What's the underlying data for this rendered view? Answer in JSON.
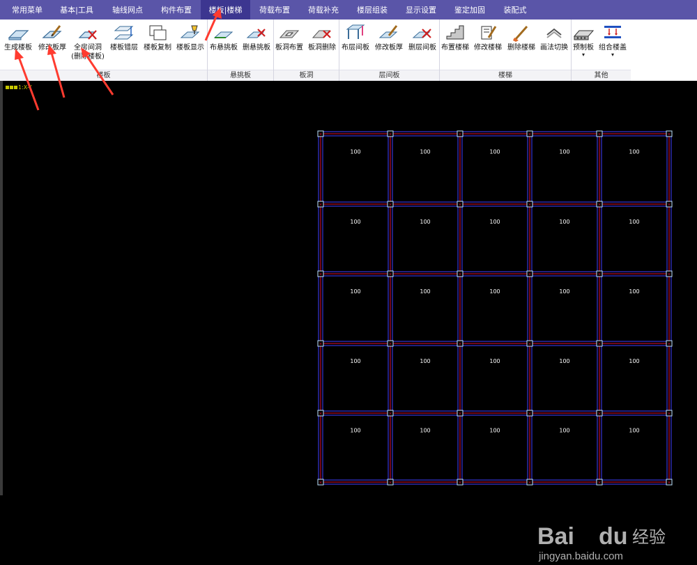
{
  "menu": [
    "常用菜单",
    "基本|工具",
    "轴线网点",
    "构件布置",
    "楼板|楼梯",
    "荷载布置",
    "荷载补充",
    "楼层组装",
    "显示设置",
    "鉴定加固",
    "装配式"
  ],
  "active_menu_index": 4,
  "tools": [
    {
      "id": "gen-slab",
      "label": "生成楼板",
      "label2": ""
    },
    {
      "id": "mod-thick",
      "label": "修改板厚",
      "label2": ""
    },
    {
      "id": "full-hole",
      "label": "全房间洞",
      "label2": "(删除楼板)"
    },
    {
      "id": "slab-offset",
      "label": "楼板错层",
      "label2": ""
    },
    {
      "id": "slab-copy",
      "label": "楼板复制",
      "label2": ""
    },
    {
      "id": "slab-show",
      "label": "楼板显示",
      "label2": ""
    },
    {
      "id": "cant-place",
      "label": "布悬挑板",
      "label2": ""
    },
    {
      "id": "cant-del",
      "label": "删悬挑板",
      "label2": ""
    },
    {
      "id": "hole-place",
      "label": "板洞布置",
      "label2": ""
    },
    {
      "id": "hole-del",
      "label": "板洞删除",
      "label2": ""
    },
    {
      "id": "interslab-place",
      "label": "布层间板",
      "label2": ""
    },
    {
      "id": "interslab-mod",
      "label": "修改板厚",
      "label2": ""
    },
    {
      "id": "interslab-del",
      "label": "删层间板",
      "label2": ""
    },
    {
      "id": "stair-place",
      "label": "布置楼梯",
      "label2": ""
    },
    {
      "id": "stair-mod",
      "label": "修改楼梯",
      "label2": ""
    },
    {
      "id": "stair-del",
      "label": "删除楼梯",
      "label2": ""
    },
    {
      "id": "draw-switch",
      "label": "画法切换",
      "label2": ""
    },
    {
      "id": "precast",
      "label": "预制板",
      "label2": "▾"
    },
    {
      "id": "combo-cover",
      "label": "组合楼盖",
      "label2": "▾"
    }
  ],
  "groups": [
    "楼板",
    "悬挑板",
    "板洞",
    "层间板",
    "楼梯",
    "其他"
  ],
  "ucs_label": "1:X-Y",
  "slab_thickness": [
    [
      100,
      100,
      100,
      100,
      100
    ],
    [
      100,
      100,
      100,
      100,
      100
    ],
    [
      100,
      100,
      100,
      100,
      100
    ],
    [
      100,
      100,
      100,
      100,
      100
    ],
    [
      100,
      100,
      100,
      100,
      100
    ]
  ],
  "watermark": {
    "brand": "Bai",
    "brand2": "du",
    "cn": "经验",
    "url": "jingyan.baidu.com"
  },
  "colors": {
    "menubar": "#5a55a8",
    "menu_active": "#3c3690",
    "beam_red": "#e01030",
    "beam_blue": "#4040ff",
    "arrow": "#ff3b2f"
  }
}
